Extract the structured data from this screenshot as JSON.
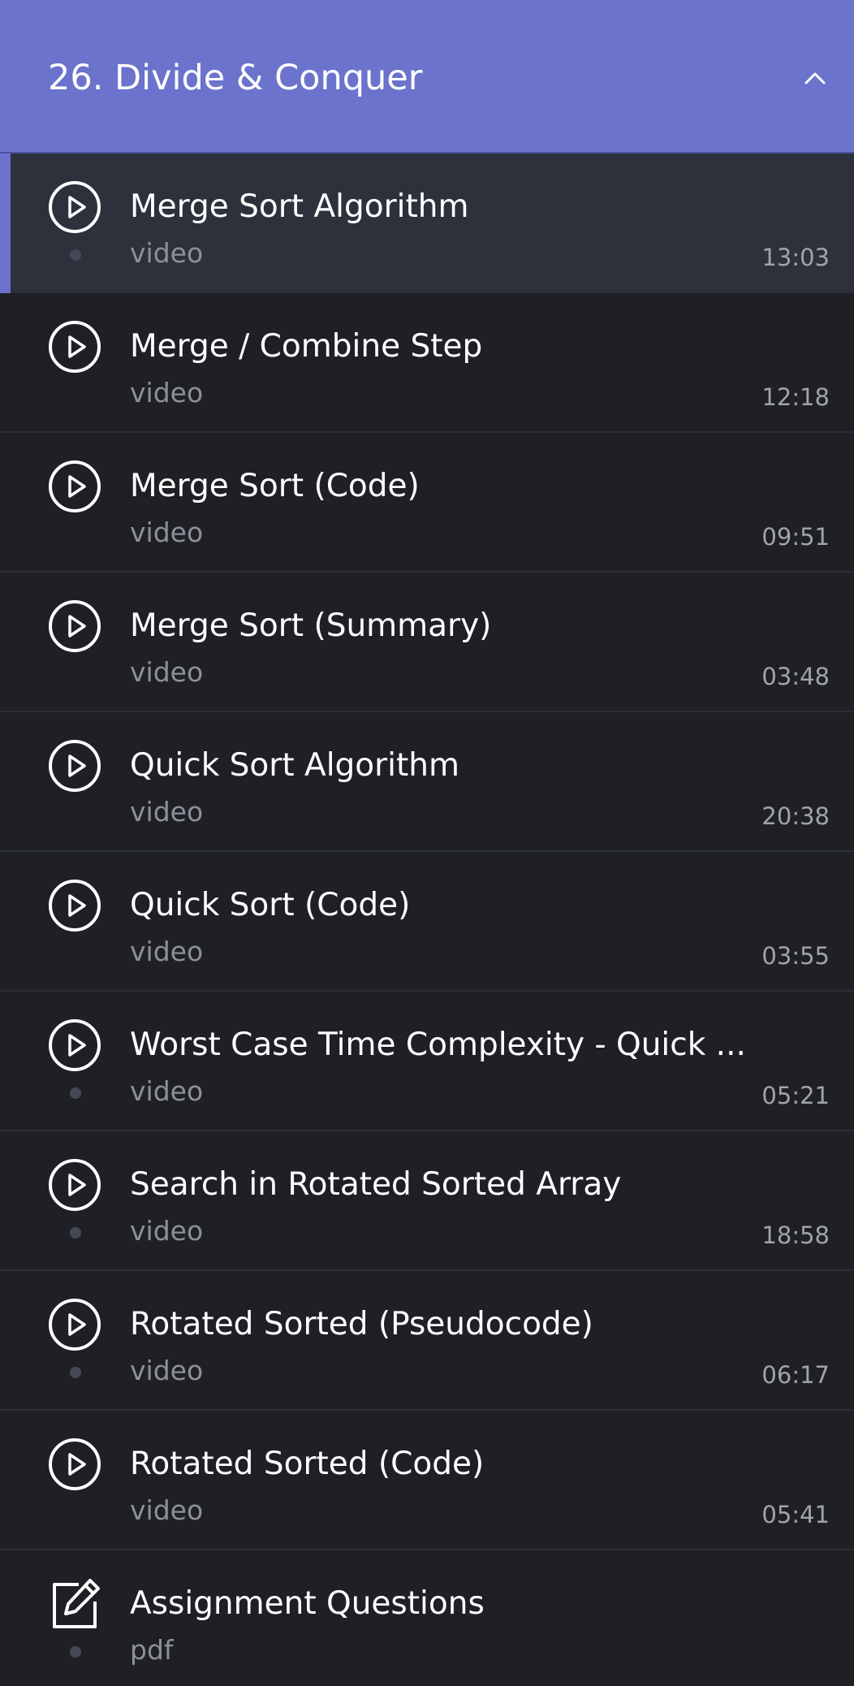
{
  "section": {
    "title": "26. Divide & Conquer",
    "collapse_icon": "chevron-up-icon",
    "header_color": "#6b73cc"
  },
  "lessons": [
    {
      "title": "Merge Sort Algorithm",
      "type": "video",
      "duration": "13:03",
      "icon": "play-circle-icon",
      "active": true,
      "dot": true
    },
    {
      "title": "Merge / Combine Step",
      "type": "video",
      "duration": "12:18",
      "icon": "play-circle-icon",
      "active": false,
      "dot": false
    },
    {
      "title": "Merge Sort (Code)",
      "type": "video",
      "duration": "09:51",
      "icon": "play-circle-icon",
      "active": false,
      "dot": false
    },
    {
      "title": "Merge Sort (Summary)",
      "type": "video",
      "duration": "03:48",
      "icon": "play-circle-icon",
      "active": false,
      "dot": false
    },
    {
      "title": "Quick Sort Algorithm",
      "type": "video",
      "duration": "20:38",
      "icon": "play-circle-icon",
      "active": false,
      "dot": false
    },
    {
      "title": "Quick Sort (Code)",
      "type": "video",
      "duration": "03:55",
      "icon": "play-circle-icon",
      "active": false,
      "dot": false
    },
    {
      "title": "Worst Case Time Complexity - Quick ...",
      "type": "video",
      "duration": "05:21",
      "icon": "play-circle-icon",
      "active": false,
      "dot": true
    },
    {
      "title": "Search in Rotated Sorted Array",
      "type": "video",
      "duration": "18:58",
      "icon": "play-circle-icon",
      "active": false,
      "dot": true
    },
    {
      "title": "Rotated Sorted (Pseudocode)",
      "type": "video",
      "duration": "06:17",
      "icon": "play-circle-icon",
      "active": false,
      "dot": true
    },
    {
      "title": "Rotated Sorted (Code)",
      "type": "video",
      "duration": "05:41",
      "icon": "play-circle-icon",
      "active": false,
      "dot": false
    },
    {
      "title": "Assignment Questions",
      "type": "pdf",
      "duration": "",
      "icon": "edit-document-icon",
      "active": false,
      "dot": true
    }
  ],
  "colors": {
    "accent": "#6b73cc",
    "row_bg": "#1f2025",
    "active_row_bg": "#2c313c",
    "title_text": "#ffffff",
    "meta_text": "#8d9099"
  }
}
